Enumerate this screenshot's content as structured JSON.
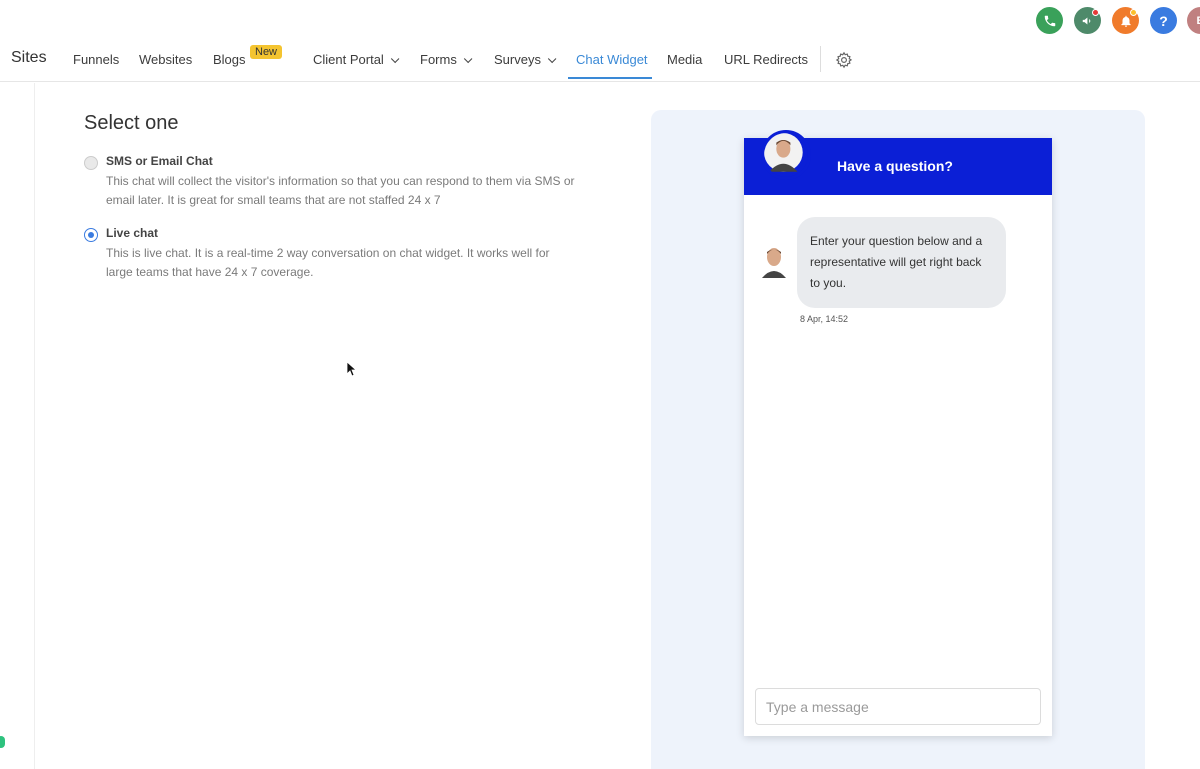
{
  "top_icons": [
    {
      "name": "phone-icon",
      "color": "#3aa15a"
    },
    {
      "name": "announcement-icon",
      "color": "#4e8a6a"
    },
    {
      "name": "bell-icon",
      "color": "#f07b2b"
    },
    {
      "name": "help-icon",
      "label": "?",
      "color": "#3a7be0"
    },
    {
      "name": "user-avatar",
      "label": "B",
      "color": "#c08080"
    }
  ],
  "nav": {
    "title": "Sites",
    "items": [
      {
        "label": "Funnels"
      },
      {
        "label": "Websites"
      },
      {
        "label": "Blogs",
        "badge": "New"
      },
      {
        "label": "Client Portal",
        "dropdown": true
      },
      {
        "label": "Forms",
        "dropdown": true
      },
      {
        "label": "Surveys",
        "dropdown": true
      },
      {
        "label": "Chat Widget",
        "active": true
      },
      {
        "label": "Media"
      },
      {
        "label": "URL Redirects"
      }
    ],
    "accent_color": "#3a89d6"
  },
  "form": {
    "heading": "Select one",
    "options": [
      {
        "label": "SMS or Email Chat",
        "description": "This chat will collect the visitor's information so that you can respond to them via SMS or email later. It is great for small teams that are not staffed 24 x 7",
        "selected": false
      },
      {
        "label": "Live chat",
        "description": "This is live chat. It is a real-time 2 way conversation on chat widget. It works well for large teams that have 24 x 7 coverage.",
        "selected": true
      }
    ]
  },
  "widget": {
    "header_title": "Have a question?",
    "header_color": "#0b1fd6",
    "message": "Enter your question below and a representative will get right back to you.",
    "message_time": "8 Apr, 14:52",
    "input_placeholder": "Type a message"
  }
}
